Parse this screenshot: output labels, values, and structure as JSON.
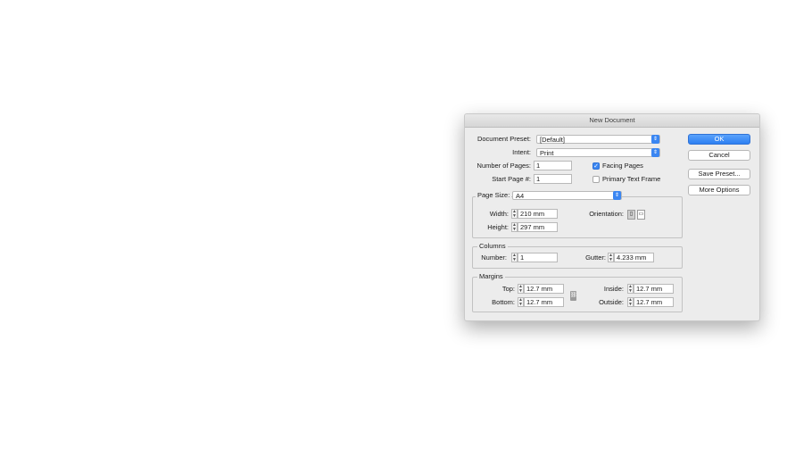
{
  "window": {
    "title": "New Document"
  },
  "document_preset": {
    "label": "Document Preset:",
    "value": "[Default]"
  },
  "intent": {
    "label": "Intent:",
    "value": "Print"
  },
  "number_of_pages": {
    "label": "Number of Pages:",
    "value": "1"
  },
  "start_page": {
    "label": "Start Page #:",
    "value": "1"
  },
  "facing_pages": {
    "label": "Facing Pages",
    "checked": true
  },
  "primary_text_frame": {
    "label": "Primary Text Frame",
    "checked": false
  },
  "page_size": {
    "label": "Page Size:",
    "value": "A4",
    "width_label": "Width:",
    "width_value": "210 mm",
    "height_label": "Height:",
    "height_value": "297 mm",
    "orientation_label": "Orientation:",
    "orientation_selected": "portrait"
  },
  "columns": {
    "title": "Columns",
    "number_label": "Number:",
    "number_value": "1",
    "gutter_label": "Gutter:",
    "gutter_value": "4.233 mm"
  },
  "margins": {
    "title": "Margins",
    "top_label": "Top:",
    "top_value": "12.7 mm",
    "bottom_label": "Bottom:",
    "bottom_value": "12.7 mm",
    "inside_label": "Inside:",
    "inside_value": "12.7 mm",
    "outside_label": "Outside:",
    "outside_value": "12.7 mm"
  },
  "buttons": {
    "ok": "OK",
    "cancel": "Cancel",
    "save_preset": "Save Preset...",
    "more_options": "More Options"
  },
  "colors": {
    "accent": "#3a86f2",
    "dialog_bg": "#ececec"
  }
}
